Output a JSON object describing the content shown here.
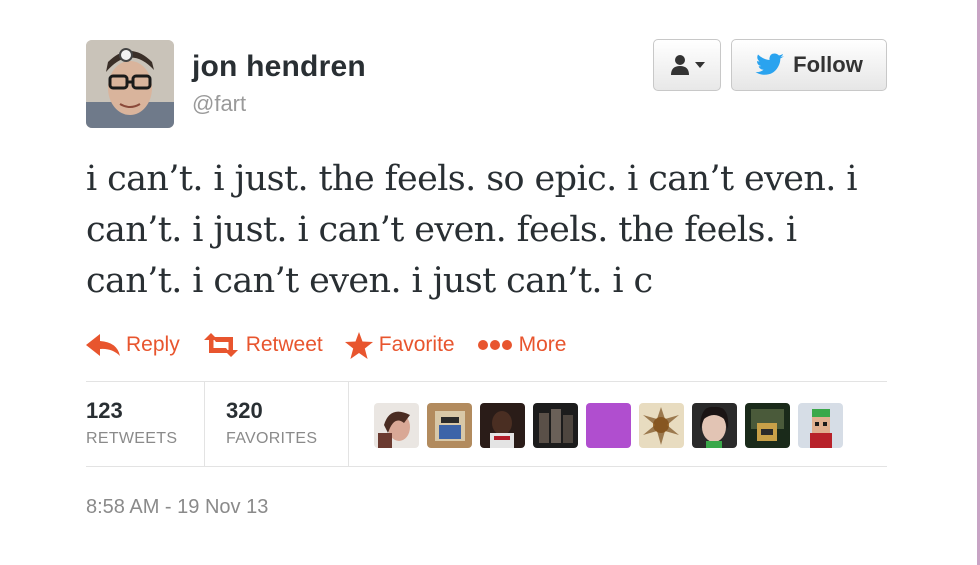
{
  "author": {
    "name": "jon hendren",
    "handle": "@fart"
  },
  "buttons": {
    "user_menu_icon": "person-with-caret-icon",
    "follow_label": "Follow"
  },
  "tweet": {
    "text": "i can’t. i just. the feels. so epic. i can’t even. i can’t. i just. i can’t even. feels. the feels. i can’t. i can’t even. i just can’t. i c"
  },
  "actions": [
    {
      "label": "Reply",
      "icon": "reply-arrow-icon"
    },
    {
      "label": "Retweet",
      "icon": "retweet-icon"
    },
    {
      "label": "Favorite",
      "icon": "star-icon"
    },
    {
      "label": "More",
      "icon": "more-dots-icon"
    }
  ],
  "stats": {
    "retweets_count": "123",
    "retweets_label": "RETWEETS",
    "favorites_count": "320",
    "favorites_label": "FAVORITES"
  },
  "favorited_by_avatars": 9,
  "timestamp": "8:58 AM - 19 Nov 13",
  "colors": {
    "action_orange": "#e8552e",
    "twitter_blue": "#2aa3ef",
    "text_dark": "#292f33",
    "muted_gray": "#8a8a8a"
  }
}
